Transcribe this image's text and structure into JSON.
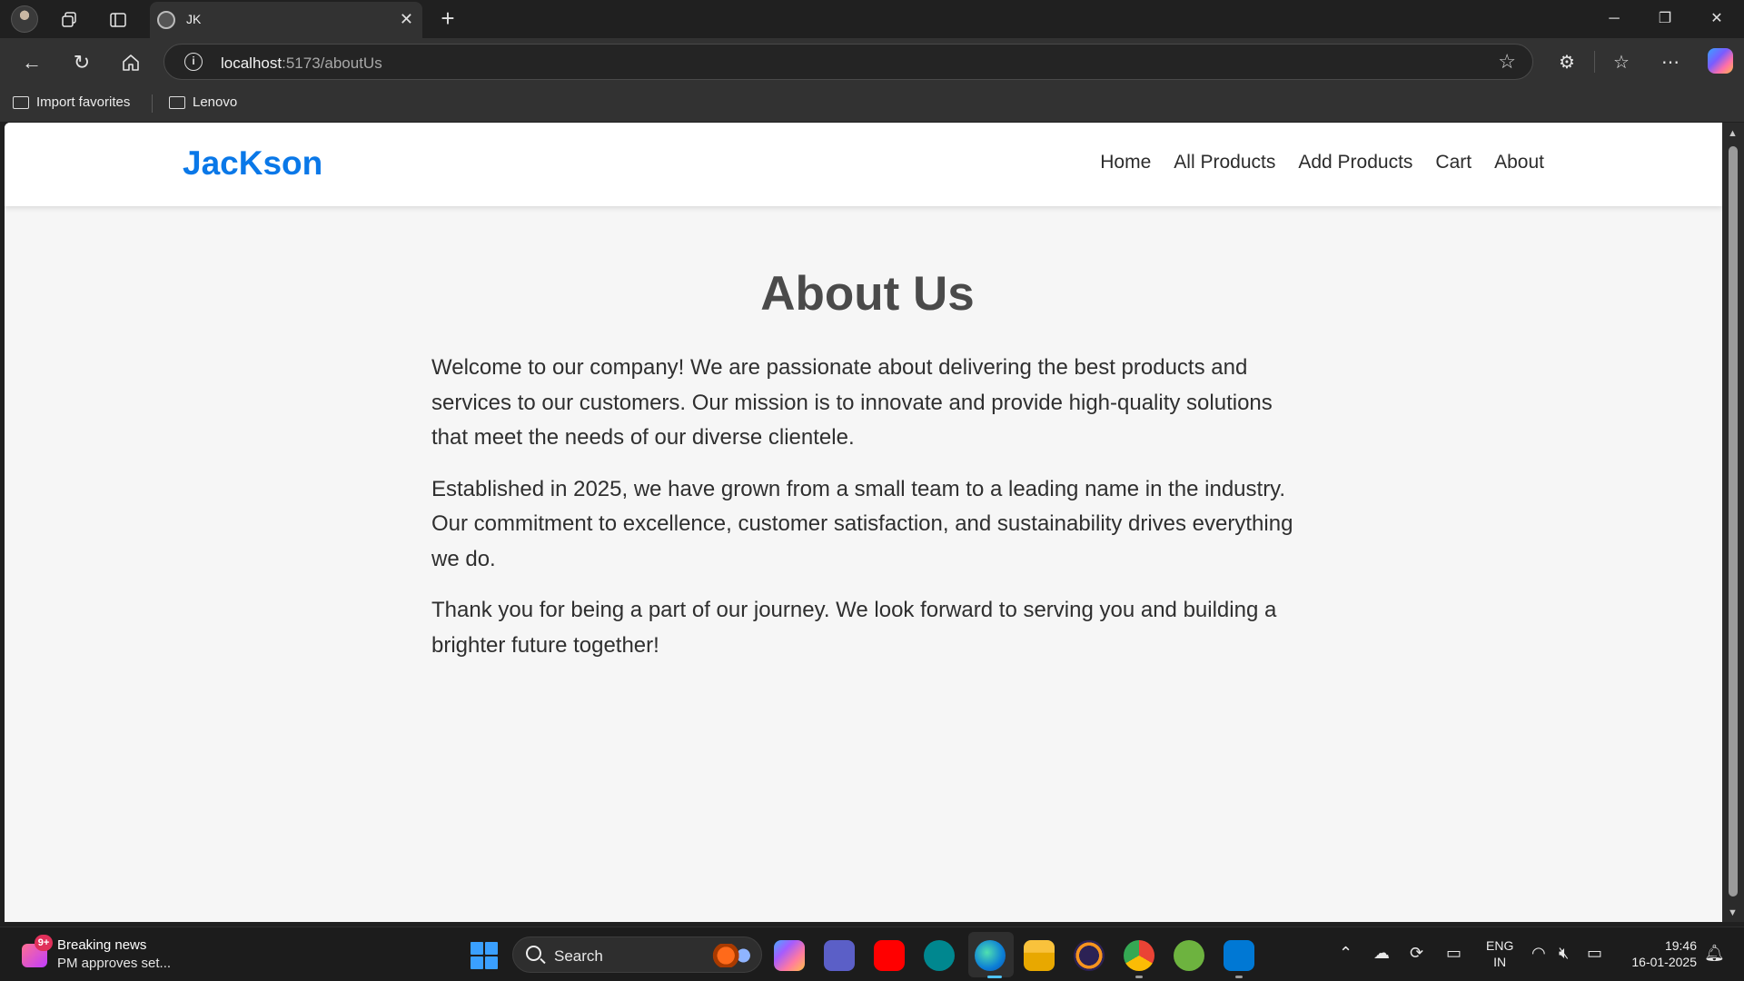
{
  "browser": {
    "tab_title": "JK",
    "address_host": "localhost",
    "address_rest": ":5173/aboutUs",
    "favorites": [
      {
        "label": "Import favorites"
      },
      {
        "label": "Lenovo"
      }
    ]
  },
  "site": {
    "brand": "JacKson",
    "nav": [
      "Home",
      "All Products",
      "Add Products",
      "Cart",
      "About"
    ],
    "brand_color": "#0a78e8"
  },
  "page": {
    "heading": "About Us",
    "paragraphs": [
      "Welcome to our company! We are passionate about delivering the best products and services to our customers. Our mission is to innovate and provide high-quality solutions that meet the needs of our diverse clientele.",
      "Established in 2025, we have grown from a small team to a leading name in the industry. Our commitment to excellence, customer satisfaction, and sustainability drives everything we do.",
      "Thank you for being a part of our journey. We look forward to serving you and building a brighter future together!"
    ]
  },
  "taskbar": {
    "news_badge": "9+",
    "news_title": "Breaking news",
    "news_subtitle": "PM approves set...",
    "search_label": "Search",
    "language_line1": "ENG",
    "language_line2": "IN",
    "time": "19:46",
    "date": "16-01-2025",
    "apps": [
      "copilot-app-icon",
      "teams-icon",
      "youtube-icon",
      "arduino-icon",
      "edge-icon",
      "file-explorer-icon",
      "eclipse-icon",
      "chrome-icon",
      "spring-tools-icon",
      "vscode-icon"
    ]
  }
}
